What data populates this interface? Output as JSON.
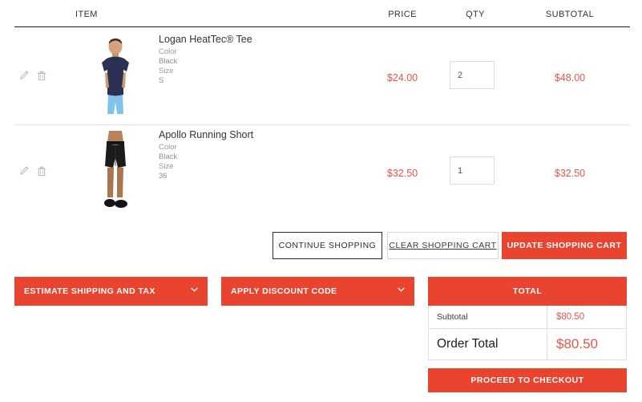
{
  "theme": {
    "accent": "#e8442f",
    "price_text": "#e0574a",
    "border_light": "#e0e0e0",
    "header_rule": "#1c1c1c"
  },
  "table": {
    "columns": {
      "item": "ITEM",
      "price": "PRICE",
      "qty": "QTY",
      "subtotal": "SUBTOTAL"
    }
  },
  "items": [
    {
      "name": "Logan HeatTec® Tee",
      "color_label": "Color",
      "color_value": "Black",
      "size_label": "Size",
      "size_value": "S",
      "price": "$24.00",
      "qty": "2",
      "subtotal": "$48.00",
      "edit_icon": "pencil-icon",
      "delete_icon": "trash-icon",
      "image": "navy-tee-on-model"
    },
    {
      "name": "Apollo Running Short",
      "color_label": "Color",
      "color_value": "Black",
      "size_label": "Size",
      "size_value": "36",
      "price": "$32.50",
      "qty": "1",
      "subtotal": "$32.50",
      "edit_icon": "pencil-icon",
      "delete_icon": "trash-icon",
      "image": "black-running-short-on-model"
    }
  ],
  "actions": {
    "continue_shopping": "Continue Shopping",
    "clear_cart": "Clear Shopping Cart",
    "update_cart": "Update Shopping Cart"
  },
  "panels": [
    {
      "title": "Estimate Shipping and Tax",
      "icon": "chevron-down-icon"
    },
    {
      "title": "Apply Discount Code",
      "icon": "chevron-down-icon"
    }
  ],
  "summary": {
    "heading": "Total",
    "subtotal_label": "Subtotal",
    "subtotal_value": "$80.50",
    "order_total_label": "Order Total",
    "order_total_value": "$80.50",
    "checkout_label": "Proceed to Checkout"
  }
}
